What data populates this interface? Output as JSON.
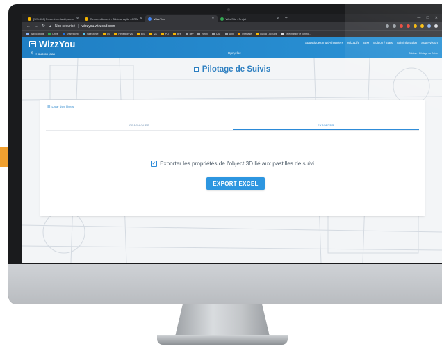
{
  "browser": {
    "tabs": [
      {
        "label": "[WS-506] Paramétrer la dépense"
      },
      {
        "label": "Renouvellement - Tableau Agile - JIRA"
      },
      {
        "label": "WizzYou"
      },
      {
        "label": "WizzSite - Projet"
      }
    ],
    "address": {
      "security": "Non sécurisé",
      "url": "wizzyou.wizzcad.com"
    },
    "bookmarks": [
      "Applications",
      "Drive",
      "sharepoint",
      "Salesforce",
      "VS",
      "Réflexion VA",
      "BIM",
      "VA",
      "PO",
      "Bre",
      "dev",
      "hetell",
      "UAT",
      "App",
      "Firebase",
      "Lucca | Accueil",
      "Télécharger le contrôl..."
    ]
  },
  "header": {
    "logo": "WizzYou",
    "nav": [
      "Statistiques multi-chantiers",
      "WizzLife",
      "BIM",
      "Edition / stats",
      "Administration",
      "Supervision"
    ],
    "user": "Houbron jean",
    "company": "Upcycles",
    "breadcrumb": "Tableau / Pilotage de Suivis"
  },
  "page": {
    "title": "Pilotage de Suivis",
    "list_link": "Liste des filtres",
    "tabs": [
      "GRAPHIQUES",
      "EXPORTER"
    ],
    "export_label": "Exporter les propriétés de l'object 3D lié aux pastilles de suivi",
    "export_checked": true,
    "export_button": "EXPORT EXCEL"
  },
  "colors": {
    "accent": "#2d96e0",
    "header": "#1f7fc4",
    "orange": "#f0a030"
  }
}
